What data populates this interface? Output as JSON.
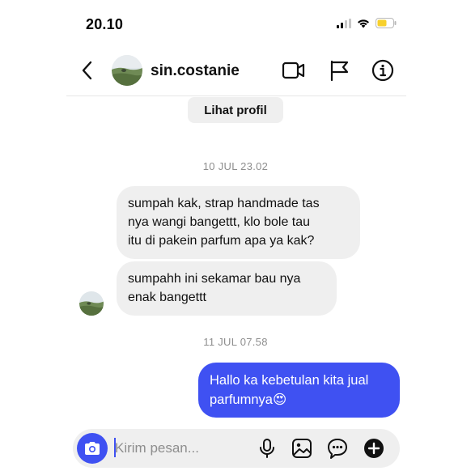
{
  "status_bar": {
    "time": "20.10"
  },
  "header": {
    "username": "sin.costanie"
  },
  "profile_button": {
    "label": "Lihat profil"
  },
  "conversation": [
    {
      "type": "timestamp",
      "text": "10 JUL 23.02"
    },
    {
      "type": "incoming",
      "lines": [
        "sumpah kak, strap handmade tas",
        "nya wangi bangettt, klo bole tau",
        "itu di pakein parfum apa ya kak?"
      ]
    },
    {
      "type": "incoming",
      "lines": [
        "sumpahh ini sekamar bau nya",
        "enak bangettt"
      ]
    },
    {
      "type": "timestamp",
      "text": "11 JUL 07.58"
    },
    {
      "type": "outgoing",
      "lines": [
        "Hallo ka kebetulan kita jual",
        "parfumnya"
      ],
      "emoji": "😍"
    }
  ],
  "composer": {
    "placeholder": "Kirim pesan..."
  },
  "colors": {
    "accent": "#3f51f2",
    "incoming_bubble": "#efefef",
    "timestamp": "#8e8e8e",
    "battery": "#f7d02c"
  },
  "icons": [
    "back-arrow-icon",
    "video-camera-icon",
    "flag-icon",
    "info-icon",
    "camera-icon",
    "microphone-icon",
    "gallery-icon",
    "sticker-icon",
    "add-icon",
    "signal-icon",
    "wifi-icon",
    "battery-icon"
  ]
}
